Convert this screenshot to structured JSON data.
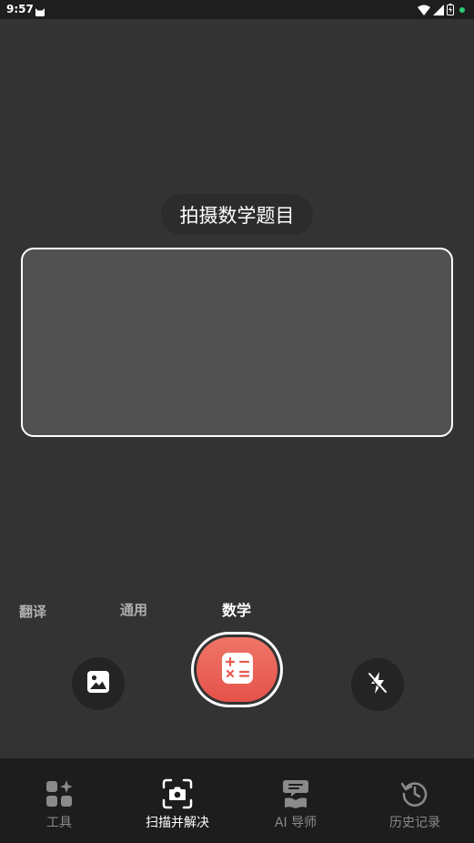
{
  "status_bar": {
    "time": "9:57",
    "notification_icon": "cat-icon",
    "icons": [
      "wifi-icon",
      "signal-icon",
      "battery-icon",
      "dot-icon"
    ],
    "dot_color": "#2ecc71"
  },
  "camera": {
    "hint": "拍摄数学题目"
  },
  "modes": {
    "items": [
      "翻译",
      "通用",
      "数学"
    ],
    "selected": "数学"
  },
  "controls": {
    "gallery_icon": "image-icon",
    "shutter_icon": "calculator-icon",
    "flash_icon": "flash-off-icon",
    "shutter_color": "#e85a4f"
  },
  "tab_bar": {
    "tabs": [
      {
        "label": "工具",
        "icon": "tools-grid-icon"
      },
      {
        "label": "扫描并解决",
        "icon": "scan-camera-icon"
      },
      {
        "label": "AI 导师",
        "icon": "ai-tutor-icon"
      },
      {
        "label": "历史记录",
        "icon": "history-icon"
      }
    ],
    "active": "扫描并解决"
  }
}
